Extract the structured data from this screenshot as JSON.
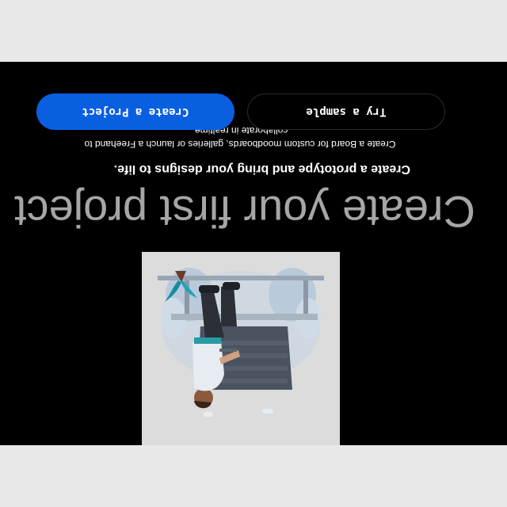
{
  "main": {
    "title": "Create your first project",
    "subtitle": "Create a prototype and bring your designs to life.",
    "description": "Create a Board for custom moodboards, galleries or launch a Freehand to collaborate in realtime.",
    "illustration_icon": "person-working-at-desk-illustration"
  },
  "actions": {
    "try_sample_label": "Try a sample",
    "create_project_label": "Create a Project"
  },
  "colors": {
    "panel_background": "#000000",
    "page_background": "#e8e8e8",
    "accent": "#0a5fe0",
    "title_text": "#a6a6a6"
  },
  "display": {
    "orientation": "rotated-180"
  }
}
